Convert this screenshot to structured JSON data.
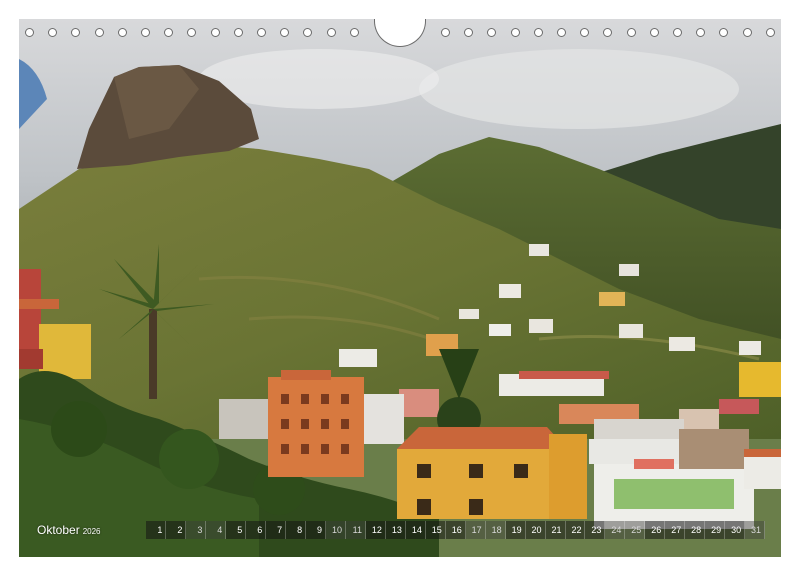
{
  "calendar": {
    "month": "Oktober",
    "year": "2026",
    "days": [
      "1",
      "2",
      "3",
      "4",
      "5",
      "6",
      "7",
      "8",
      "9",
      "10",
      "11",
      "12",
      "13",
      "14",
      "15",
      "16",
      "17",
      "18",
      "19",
      "20",
      "21",
      "22",
      "23",
      "24",
      "25",
      "26",
      "27",
      "28",
      "29",
      "30",
      "31"
    ],
    "weekend_days": [
      "3",
      "4",
      "10",
      "11",
      "17",
      "18",
      "24",
      "25",
      "31"
    ]
  },
  "photo": {
    "subject": "mountain-village-landscape"
  },
  "colors": {
    "sky": "#c9ccd0",
    "mountain": "#4d5f2c",
    "rock": "#5a4a3a",
    "orange_building": "#d7793f",
    "yellow_building": "#e2a93a",
    "roof": "#c9663a"
  }
}
